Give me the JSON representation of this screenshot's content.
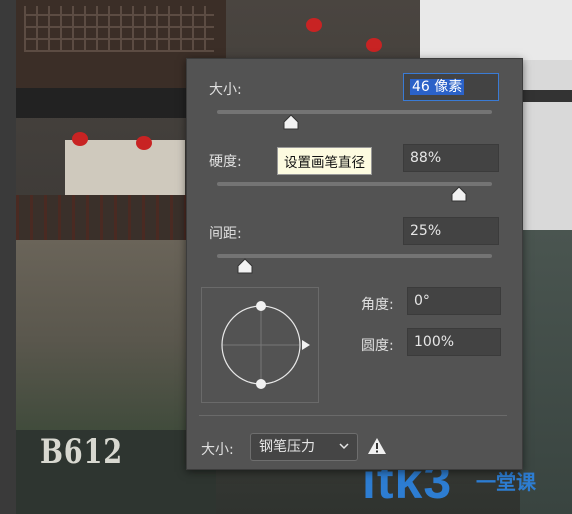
{
  "panel": {
    "size": {
      "label": "大小:",
      "value": "46 像素",
      "level": 0.27
    },
    "hardness": {
      "label": "硬度:",
      "value": "88%",
      "level": 0.88
    },
    "spacing": {
      "label": "间距:",
      "value": "25%",
      "level": 0.1
    },
    "angle": {
      "label": "角度:",
      "value": "0°"
    },
    "roundness": {
      "label": "圆度:",
      "value": "100%"
    },
    "tooltip": "设置画笔直径",
    "control": {
      "label": "大小:",
      "selected": "钢笔压力"
    },
    "warning_icon": "warning-icon",
    "accent_color": "#2b62c8"
  },
  "background": {
    "watermark_left": "B612",
    "watermark_right": "itk3",
    "watermark_sub": "一堂课"
  }
}
